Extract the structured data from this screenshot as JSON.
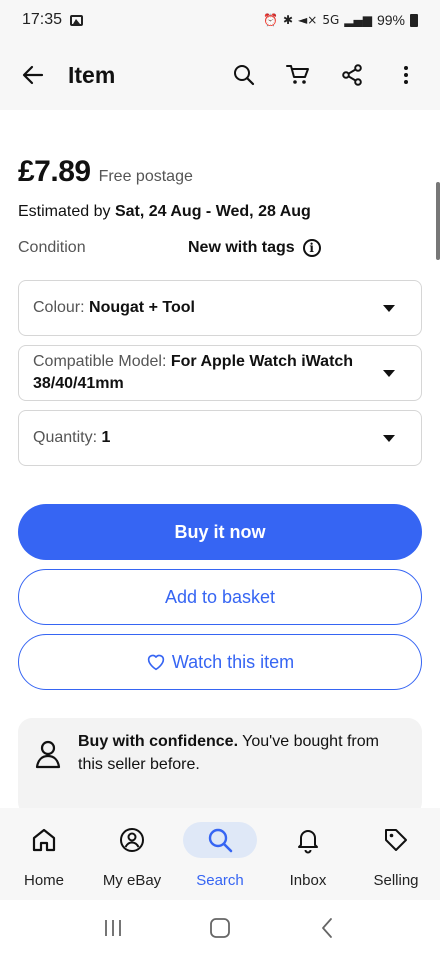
{
  "status": {
    "time": "17:35",
    "battery": "99%",
    "network": "5G"
  },
  "header": {
    "title": "Item"
  },
  "item": {
    "price": "£7.89",
    "postage": "Free postage",
    "estimate_prefix": "Estimated by ",
    "estimate_dates": "Sat, 24 Aug - Wed, 28 Aug",
    "condition_label": "Condition",
    "condition_value": "New with tags"
  },
  "selectors": [
    {
      "label": "Colour: ",
      "value": "Nougat + Tool"
    },
    {
      "label": "Compatible Model: ",
      "value": "For Apple Watch iWatch 38/40/41mm"
    },
    {
      "label": "Quantity: ",
      "value": "1"
    }
  ],
  "actions": {
    "buy_now": "Buy it now",
    "add_to_basket": "Add to basket",
    "watch": "Watch this item"
  },
  "confidence": {
    "title": "Buy with confidence.",
    "text": " You've bought from this seller before."
  },
  "nav": [
    {
      "label": "Home",
      "icon": "home-icon"
    },
    {
      "label": "My eBay",
      "icon": "user-icon"
    },
    {
      "label": "Search",
      "icon": "search-icon",
      "active": true
    },
    {
      "label": "Inbox",
      "icon": "bell-icon"
    },
    {
      "label": "Selling",
      "icon": "tag-icon"
    }
  ],
  "colors": {
    "accent": "#3665f3",
    "active_nav_bg": "#dfe8f7"
  }
}
